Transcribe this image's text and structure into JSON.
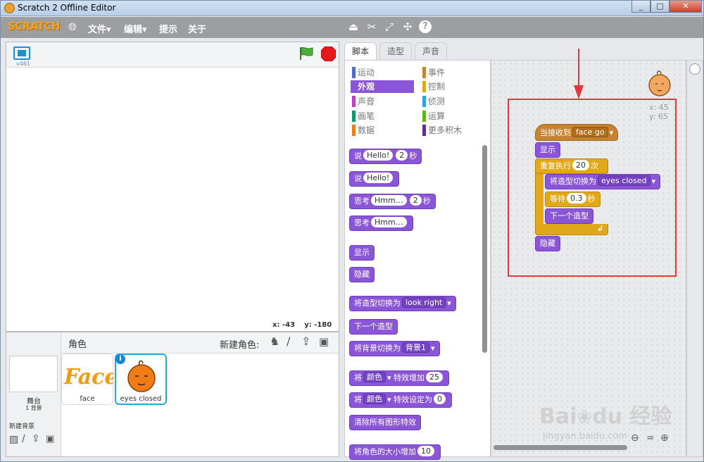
{
  "window": {
    "title": "Scratch 2 Offline Editor",
    "controls": [
      "_",
      "□",
      "✕"
    ]
  },
  "menu": {
    "logo": "SCRATCH",
    "file": "文件▾",
    "edit": "编辑▾",
    "tips": "提示",
    "about": "关于"
  },
  "stage": {
    "version": "v461",
    "coords_x": "x: -43",
    "coords_y": "y: -180"
  },
  "sprites": {
    "header_label": "角色",
    "new_sprite_label": "新建角色:",
    "stage_label": "舞台",
    "stage_backdrops": "1 背景",
    "new_backdrop_label": "新建背景",
    "items": [
      {
        "name": "face"
      },
      {
        "name": "eyes closed"
      }
    ],
    "info_icon": "i"
  },
  "tabs": {
    "scripts": "脚本",
    "costumes": "造型",
    "sounds": "声音"
  },
  "categories": {
    "motion": "运动",
    "looks": "外观",
    "sound": "声音",
    "pen": "画笔",
    "data": "数据",
    "events": "事件",
    "control": "控制",
    "sensing": "侦测",
    "operators": "运算",
    "more": "更多积木"
  },
  "palette_blocks": {
    "say_for": {
      "pre": "说",
      "text": "Hello!",
      "num": "2",
      "post": "秒"
    },
    "say": {
      "pre": "说",
      "text": "Hello!"
    },
    "think_for": {
      "pre": "思考",
      "text": "Hmm…",
      "num": "2",
      "post": "秒"
    },
    "think": {
      "pre": "思考",
      "text": "Hmm…"
    },
    "show": "显示",
    "hide": "隐藏",
    "switch_costume": {
      "pre": "将造型切换为",
      "value": "look right"
    },
    "next_costume": "下一个造型",
    "switch_backdrop": {
      "pre": "将背景切换为",
      "value": "背景1"
    },
    "change_effect": {
      "pre": "将",
      "value": "颜色",
      "mid": "特效增加",
      "num": "25"
    },
    "set_effect": {
      "pre": "将",
      "value": "颜色",
      "mid": "特效设定为",
      "num": "0"
    },
    "clear_effects": "清除所有图形特效",
    "change_size": {
      "pre": "将角色的大小增加",
      "num": "10"
    }
  },
  "script": {
    "sprite_x": "x: 45",
    "sprite_y": "y: 65",
    "when_receive": {
      "pre": "当接收到",
      "value": "face go"
    },
    "show": "显示",
    "repeat": {
      "pre": "重复执行",
      "num": "20",
      "post": "次"
    },
    "switch_costume": {
      "pre": "将造型切换为",
      "value": "eyes closed"
    },
    "wait": {
      "pre": "等待",
      "num": "0.3",
      "post": "秒"
    },
    "next_costume": "下一个造型",
    "hide": "隐藏"
  },
  "colors": {
    "motion": "#4a6cd4",
    "looks": "#8a55d7",
    "sound": "#bb42c3",
    "pen": "#0e9a6c",
    "data": "#ee7d16",
    "events": "#c88330",
    "control": "#e1a91a",
    "sensing": "#2ca5e2",
    "operators": "#5cb712",
    "more": "#632d99"
  }
}
